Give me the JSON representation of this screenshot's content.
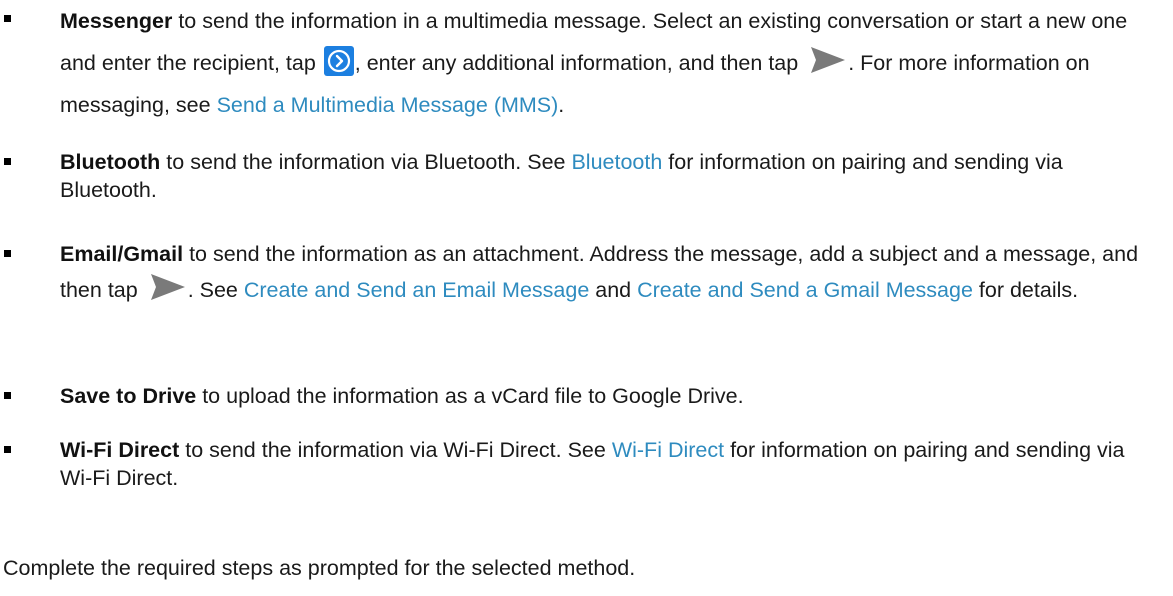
{
  "items": [
    {
      "term": "Messenger",
      "text1": " to send the information in a multimedia message. Select an existing conversation or start a new one and enter the recipient, tap ",
      "text2": ", enter any additional information, and then tap ",
      "text3": ". For more information on messaging, see ",
      "link1": "Send a Multimedia Message (MMS)",
      "text4": "."
    },
    {
      "term": "Bluetooth",
      "text1": " to send the information via Bluetooth. See ",
      "link1": "Bluetooth",
      "text2": " for information on pairing and sending via Bluetooth."
    },
    {
      "term": "Email/Gmail",
      "text1": " to send the information as an attachment. Address the message, add a subject and a message, and then tap ",
      "text2": ". See ",
      "link1": "Create and Send an Email Message",
      "text3": " and ",
      "link2": "Create and Send a Gmail Message",
      "text4": " for details."
    },
    {
      "term": "Save to Drive",
      "text1": " to upload the information as a vCard file to Google Drive."
    },
    {
      "term": "Wi-Fi Direct",
      "text1": " to send the information via Wi-Fi Direct. See ",
      "link1": "Wi-Fi Direct",
      "text2": " for information on pairing and sending via Wi-Fi Direct."
    }
  ],
  "footer": "Complete the required steps as prompted for the selected method.",
  "icons": {
    "next": "chevron-right-circle-icon",
    "send": "send-arrow-icon"
  },
  "colors": {
    "link": "#2e8bbf",
    "icon_blue": "#1c7fe0",
    "send_gray": "#7a7a7a"
  }
}
